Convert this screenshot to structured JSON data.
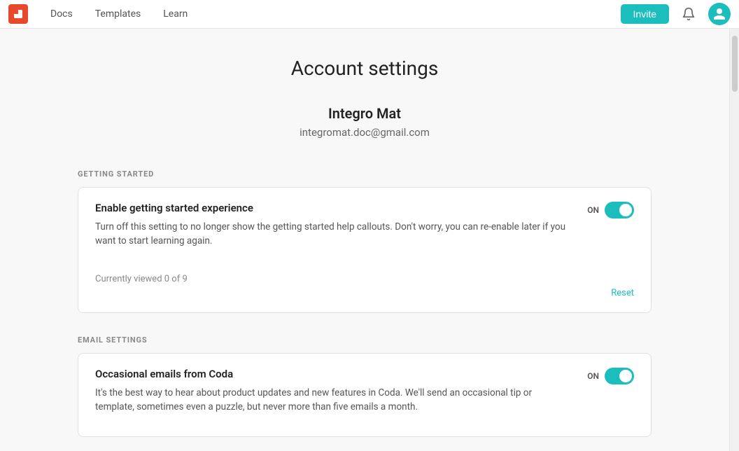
{
  "nav": {
    "docs_label": "Docs",
    "templates_label": "Templates",
    "learn_label": "Learn",
    "invite_label": "Invite"
  },
  "page": {
    "title": "Account settings"
  },
  "user": {
    "name": "Integro Mat",
    "email": "integromat.doc@gmail.com"
  },
  "sections": {
    "getting_started": {
      "label": "GETTING STARTED",
      "card": {
        "title": "Enable getting started experience",
        "description": "Turn off this setting to no longer show the getting started help callouts. Don't worry, you can re-enable later if you want to start learning again.",
        "meta": "Currently viewed 0 of 9",
        "toggle_label": "ON",
        "reset_label": "Reset",
        "toggle_on": true
      }
    },
    "email_settings": {
      "label": "EMAIL SETTINGS",
      "card": {
        "title": "Occasional emails from Coda",
        "description": "It's the best way to hear about product updates and new features in Coda. We'll send an occasional tip or template, sometimes even a puzzle, but never more than five emails a month.",
        "toggle_label": "ON",
        "toggle_on": true
      }
    }
  },
  "icons": {
    "bell": "🔔",
    "user": "👤"
  }
}
